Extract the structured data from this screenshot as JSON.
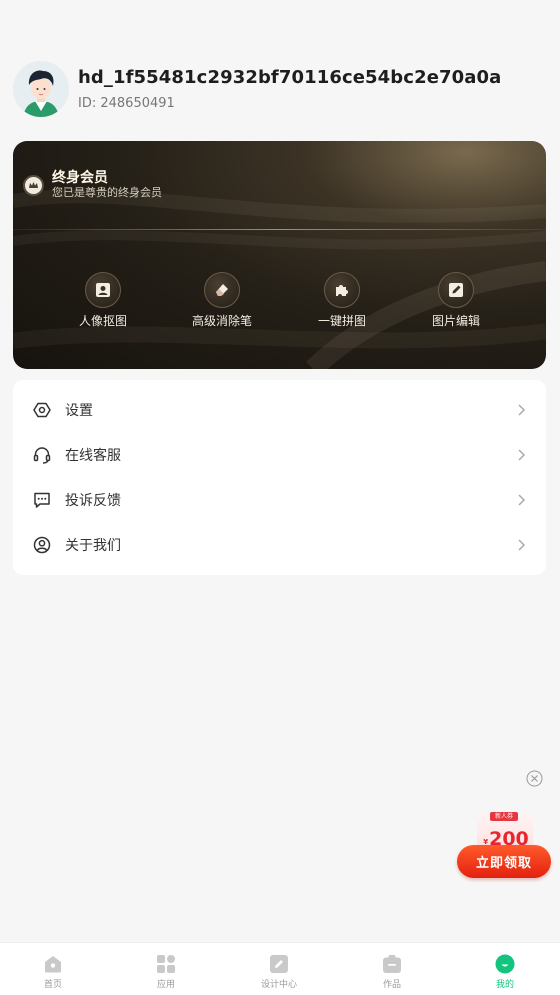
{
  "profile": {
    "username": "hd_1f55481c2932bf70116ce54bc2e70a0a",
    "user_id": "ID: 248650491"
  },
  "vip": {
    "title": "终身会员",
    "subtitle": "您已是尊贵的终身会员",
    "features": [
      {
        "label": "人像抠图",
        "icon": "portrait-cutout-icon"
      },
      {
        "label": "高级消除笔",
        "icon": "eraser-icon"
      },
      {
        "label": "一键拼图",
        "icon": "puzzle-icon"
      },
      {
        "label": "图片编辑",
        "icon": "edit-image-icon"
      }
    ]
  },
  "menu": {
    "items": [
      {
        "label": "设置",
        "icon": "settings-icon"
      },
      {
        "label": "在线客服",
        "icon": "headset-icon"
      },
      {
        "label": "投诉反馈",
        "icon": "feedback-icon"
      },
      {
        "label": "关于我们",
        "icon": "user-circle-icon"
      }
    ]
  },
  "promo": {
    "tag": "新人券",
    "currency": "¥",
    "amount": "200",
    "button_label": "立即领取"
  },
  "tabbar": {
    "active_color": "#13c47f",
    "items": [
      {
        "label": "首页",
        "icon": "home-icon"
      },
      {
        "label": "应用",
        "icon": "apps-icon"
      },
      {
        "label": "设计中心",
        "icon": "design-icon"
      },
      {
        "label": "作品",
        "icon": "works-icon"
      },
      {
        "label": "我的",
        "icon": "profile-icon"
      }
    ]
  }
}
